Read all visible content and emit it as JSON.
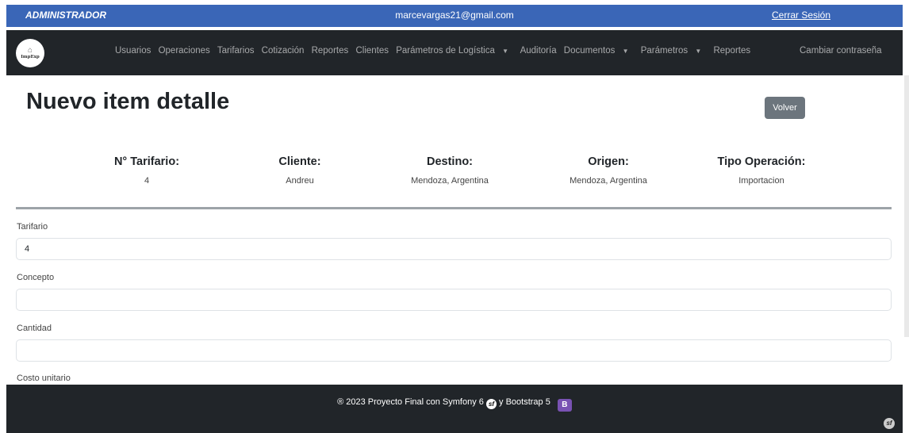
{
  "topbar": {
    "role": "ADMINISTRADOR",
    "email": "marcevargas21@gmail.com",
    "logout": "Cerrar Sesión"
  },
  "navbar": {
    "logo_text": "ImpExp",
    "items": [
      {
        "label": "Usuarios"
      },
      {
        "label": "Operaciones"
      },
      {
        "label": "Tarifarios"
      },
      {
        "label": "Cotización"
      },
      {
        "label": "Reportes"
      },
      {
        "label": "Clientes"
      },
      {
        "label": "Parámetros de Logística"
      },
      {
        "label": "Auditoría"
      },
      {
        "label": "Documentos"
      },
      {
        "label": "Parámetros"
      },
      {
        "label": "Reportes"
      }
    ],
    "change_password": "Cambiar contraseña"
  },
  "page": {
    "title": "Nuevo item detalle",
    "back_button": "Volver"
  },
  "info": [
    {
      "label": "N° Tarifario:",
      "value": "4"
    },
    {
      "label": "Cliente:",
      "value": "Andreu"
    },
    {
      "label": "Destino:",
      "value": "Mendoza, Argentina"
    },
    {
      "label": "Origen:",
      "value": "Mendoza, Argentina"
    },
    {
      "label": "Tipo Operación:",
      "value": "Importacion"
    }
  ],
  "form": {
    "tarifario_label": "Tarifario",
    "tarifario_value": "4",
    "concepto_label": "Concepto",
    "concepto_value": "",
    "cantidad_label": "Cantidad",
    "cantidad_value": "",
    "costo_label": "Costo unitario"
  },
  "footer": {
    "text_before": "® 2023 Proyecto Final con Symfony 6",
    "text_after": "y Bootstrap 5",
    "sf_glyph": "sf",
    "bs_glyph": "B"
  },
  "colors": {
    "topbar": "#3a66b7",
    "navbar": "#212529",
    "button_secondary": "#6c757d",
    "bootstrap_purple": "#7952b3"
  }
}
